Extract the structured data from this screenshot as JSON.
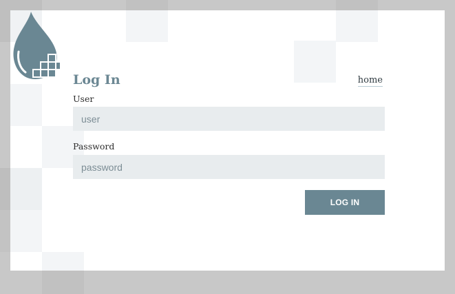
{
  "login": {
    "title": "Log In",
    "home_link": "home",
    "user_label": "User",
    "user_placeholder": "user",
    "password_label": "Password",
    "password_placeholder": "password",
    "submit_label": "LOG IN"
  },
  "colors": {
    "accent": "#6a8793",
    "input_bg": "#e8ecee",
    "page_bg": "#c8c8c8"
  }
}
